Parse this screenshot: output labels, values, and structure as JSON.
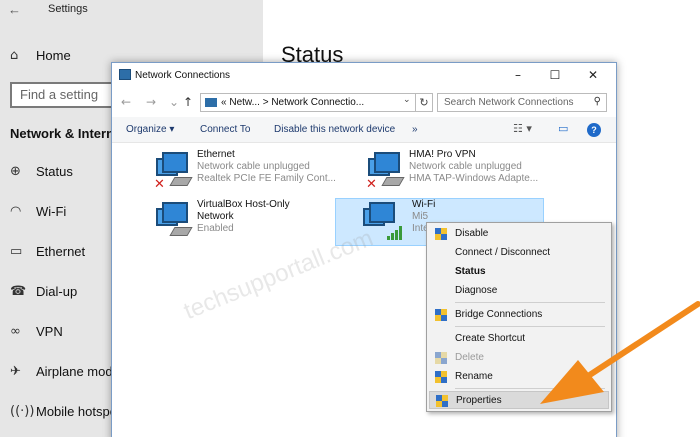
{
  "settings": {
    "back_glyph": "←",
    "title": "Settings",
    "home": "Home",
    "search_placeholder": "Find a setting",
    "section": "Network & Internet",
    "status_title": "Status",
    "items": [
      {
        "label": "Status",
        "icon": "globe-icon"
      },
      {
        "label": "Wi-Fi",
        "icon": "wifi-icon"
      },
      {
        "label": "Ethernet",
        "icon": "ethernet-icon"
      },
      {
        "label": "Dial-up",
        "icon": "dialup-icon"
      },
      {
        "label": "VPN",
        "icon": "vpn-icon"
      },
      {
        "label": "Airplane mode",
        "icon": "airplane-icon"
      },
      {
        "label": "Mobile hotspot",
        "icon": "hotspot-icon"
      }
    ]
  },
  "window": {
    "title": "Network Connections",
    "minimize": "–",
    "maximize": "☐",
    "close": "✕"
  },
  "address": {
    "crumb1": "Netw...",
    "crumb2": "Network Connectio...",
    "separator": "«",
    "arrow": ">",
    "search_placeholder": "Search Network Connections"
  },
  "toolbar": {
    "organize": "Organize ▾",
    "connect_to": "Connect To",
    "disable": "Disable this network device",
    "more": "»",
    "help": "?"
  },
  "adapters": [
    {
      "name": "Ethernet",
      "line1": "Network cable unplugged",
      "line2": "Realtek PCIe FE Family Cont...",
      "state": "unplugged"
    },
    {
      "name": "HMA! Pro VPN",
      "line1": "Network cable unplugged",
      "line2": "HMA TAP-Windows Adapte...",
      "state": "unplugged"
    },
    {
      "name": "VirtualBox Host-Only",
      "line1": "Network",
      "line2": "Enabled",
      "state": "enabled"
    },
    {
      "name": "Wi-Fi",
      "line1": "Mi5",
      "line2": "Inte",
      "state": "wifi"
    }
  ],
  "context_menu": {
    "items": [
      {
        "label": "Disable",
        "shield": true
      },
      {
        "label": "Connect / Disconnect",
        "shield": false
      },
      {
        "label": "Status",
        "shield": false,
        "bold": true
      },
      {
        "label": "Diagnose",
        "shield": false
      },
      {
        "label": "Bridge Connections",
        "shield": true
      },
      {
        "label": "Create Shortcut",
        "shield": false
      },
      {
        "label": "Delete",
        "shield": true,
        "disabled": true
      },
      {
        "label": "Rename",
        "shield": true
      },
      {
        "label": "Properties",
        "shield": true,
        "highlighted": true
      }
    ]
  },
  "watermark": "techsupportall.com",
  "colors": {
    "accent": "#1f6ac9",
    "selection": "#cde8ff",
    "arrow": "#f28a1c"
  }
}
